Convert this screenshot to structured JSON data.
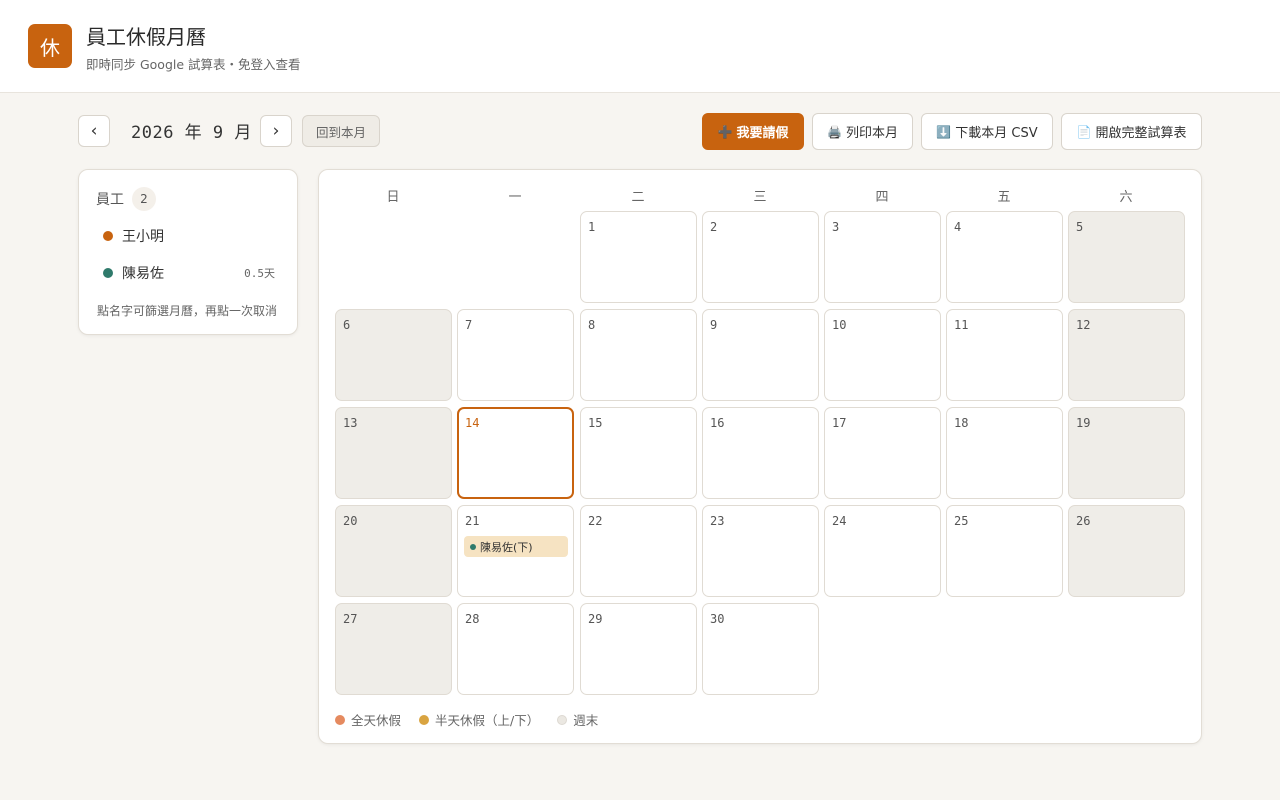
{
  "app": {
    "logo_char": "休",
    "title": "員工休假月曆",
    "subtitle": "即時同步 Google 試算表・免登入查看"
  },
  "toolbar": {
    "prev_label": "‹",
    "next_label": "›",
    "month_label": "2026 年 9 月",
    "today_label": "回到本月",
    "request_icon": "➕",
    "request_label": "我要請假",
    "print_icon": "🖨️",
    "print_label": "列印本月",
    "download_icon": "⬇️",
    "download_label": "下載本月 CSV",
    "sheet_icon": "📄",
    "sheet_label": "開啟完整試算表"
  },
  "sidebar": {
    "title": "員工",
    "count": "2",
    "employees": [
      {
        "name": "王小明",
        "color": "#c8630f",
        "days": ""
      },
      {
        "name": "陳易佐",
        "color": "#2f7a6b",
        "days": "0.5天"
      }
    ],
    "hint": "點名字可篩選月曆，再點一次取消"
  },
  "calendar": {
    "weekdays": [
      "日",
      "一",
      "二",
      "三",
      "四",
      "五",
      "六"
    ],
    "today": 14,
    "days": [
      {
        "num": "1"
      },
      {
        "num": "2"
      },
      {
        "num": "3"
      },
      {
        "num": "4"
      },
      {
        "num": "5"
      },
      {
        "num": "6"
      },
      {
        "num": "7"
      },
      {
        "num": "8"
      },
      {
        "num": "9"
      },
      {
        "num": "10"
      },
      {
        "num": "11"
      },
      {
        "num": "12"
      },
      {
        "num": "13"
      },
      {
        "num": "14"
      },
      {
        "num": "15"
      },
      {
        "num": "16"
      },
      {
        "num": "17"
      },
      {
        "num": "18"
      },
      {
        "num": "19"
      },
      {
        "num": "20"
      },
      {
        "num": "21",
        "leave": {
          "label": "陳易佐(下)",
          "color": "#2f7a6b"
        }
      },
      {
        "num": "22"
      },
      {
        "num": "23"
      },
      {
        "num": "24"
      },
      {
        "num": "25"
      },
      {
        "num": "26"
      },
      {
        "num": "27"
      },
      {
        "num": "28"
      },
      {
        "num": "29"
      },
      {
        "num": "30"
      }
    ]
  },
  "legend": [
    {
      "label": "全天休假",
      "color": "#e58a5f"
    },
    {
      "label": "半天休假（上/下）",
      "color": "#d9a441"
    },
    {
      "label": "週末",
      "color": "#ebe8e2"
    }
  ],
  "colors": {
    "accent": "#c8630f",
    "weekend_bg": "#efede8",
    "half_day_chip": "#f6e3c2"
  }
}
